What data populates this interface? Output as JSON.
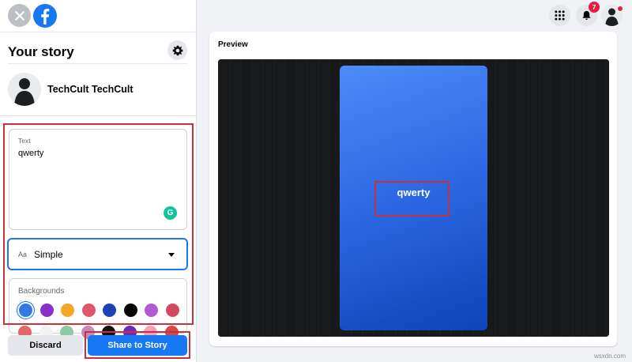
{
  "sidebar": {
    "title": "Your story",
    "user": {
      "name": "TechCult TechCult"
    },
    "text_field": {
      "label": "Text",
      "value": "qwerty"
    },
    "font_select": {
      "prefix": "Aa",
      "value": "Simple"
    },
    "backgrounds": {
      "label": "Backgrounds",
      "row1": [
        "#3578e5",
        "#8b2fc9",
        "#f5a623",
        "#e0566b",
        "#1d3fb8",
        "#050505",
        "#b05ad6",
        "#d24a5f"
      ],
      "row2": [
        "#e06a6a",
        "#f2f2f2",
        "#8cc9a6",
        "#c48ab8",
        "#111111",
        "#6a2bb5",
        "#f6a0b8",
        "#d64848"
      ]
    },
    "discard_label": "Discard",
    "share_label": "Share to Story"
  },
  "header": {
    "notification_count": "7"
  },
  "preview": {
    "label": "Preview",
    "story_text": "qwerty"
  },
  "watermark": "wsxdn.com",
  "colors": {
    "accent": "#1877f2",
    "highlight": "#c8313a"
  }
}
